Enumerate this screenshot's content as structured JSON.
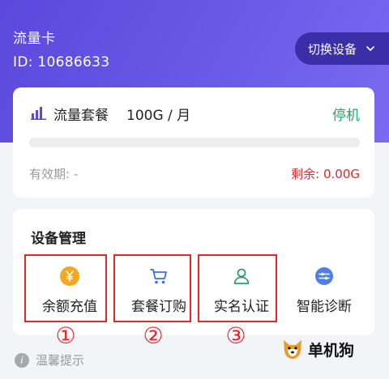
{
  "header": {
    "card_name": "流量卡",
    "card_id": "ID:  10686633",
    "switch_label": "切换设备"
  },
  "plan": {
    "title": "流量套餐",
    "value": "100G / 月",
    "status": "停机",
    "usage_fraction": 0,
    "validity": "有效期: -",
    "remaining": "剩余: 0.00G"
  },
  "device_management": {
    "title": "设备管理",
    "features": [
      {
        "label": "余额充值",
        "icon": "yen-coin-icon"
      },
      {
        "label": "套餐订购",
        "icon": "shopping-cart-icon"
      },
      {
        "label": "实名认证",
        "icon": "person-icon"
      },
      {
        "label": "智能诊断",
        "icon": "diagnosis-icon"
      }
    ]
  },
  "annotations": {
    "markers": [
      "①",
      "②",
      "③"
    ]
  },
  "footer": {
    "tip": "温馨提示"
  },
  "watermark": {
    "text": "单机狗"
  },
  "colors": {
    "brand": "#5b48dc",
    "status_green": "#20a46a",
    "remain_red": "#d12f2f",
    "highlight_red": "#e8262a"
  }
}
